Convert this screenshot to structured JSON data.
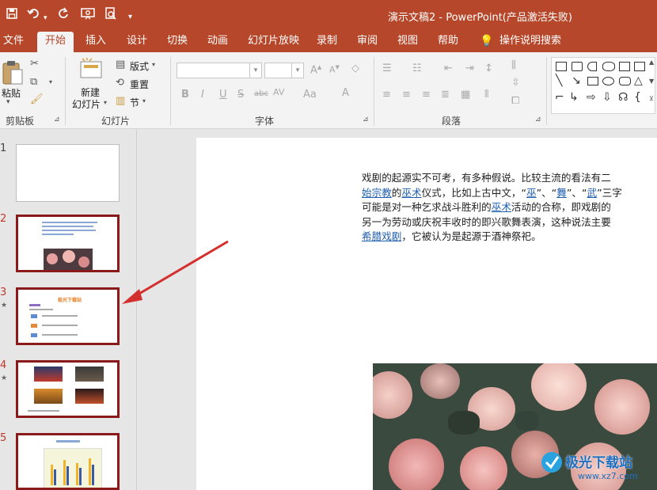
{
  "title_bar": {
    "document_title": "演示文稿2  -  PowerPoint(产品激活失败)",
    "icons": [
      "save-icon",
      "undo-icon",
      "redo-icon",
      "present-icon",
      "preview-icon",
      "customize-icon"
    ]
  },
  "tabs": [
    "文件",
    "开始",
    "插入",
    "设计",
    "切换",
    "动画",
    "幻灯片放映",
    "录制",
    "审阅",
    "视图",
    "帮助",
    "操作说明搜索"
  ],
  "active_tab": "开始",
  "ribbon": {
    "clipboard": {
      "paste": "粘贴",
      "group": "剪贴板"
    },
    "slides": {
      "new_slide_line1": "新建",
      "new_slide_line2": "幻灯片",
      "layout": "版式",
      "reset": "重置",
      "section": "节",
      "group": "幻灯片"
    },
    "font": {
      "group": "字体",
      "font_name": "",
      "font_size": ""
    },
    "paragraph": {
      "group": "段落"
    }
  },
  "thumbnails": [
    {
      "number": "1",
      "selected": false,
      "star": false
    },
    {
      "number": "2",
      "selected": true,
      "star": false
    },
    {
      "number": "3",
      "selected": true,
      "star": true,
      "heading": "极光下载站"
    },
    {
      "number": "4",
      "selected": true,
      "star": true
    },
    {
      "number": "5",
      "selected": true,
      "star": false
    }
  ],
  "slide_text": {
    "line1": "戏剧的起源实不可考，有多种假说。比较主流的看法有二",
    "line2_link1": "始宗教",
    "line2_a": "的",
    "line2_link2": "巫术",
    "line2_b": "仪式，比如上古中文，“",
    "line2_link3": "巫",
    "line2_c": "”、“",
    "line2_link4": "舞",
    "line2_d": "”、“",
    "line2_link5": "武",
    "line2_e": "”三字",
    "line3_a": "可能是对一种乞求战斗胜利的",
    "line3_link": "巫术",
    "line3_b": "活动的合称，即戏剧的",
    "line4": "另一为劳动或庆祝丰收时的即兴歌舞表演，这种说法主要",
    "line5_link": "希腊戏剧",
    "line5_b": "，它被认为是起源于酒神祭祀。"
  },
  "watermark": {
    "text": "极光下载站",
    "url": "www.xz7.com"
  },
  "colors": {
    "accent": "#b7472a",
    "link": "#1f5fb0",
    "selected_border": "#8b1a1a",
    "arrow": "#d32f2f"
  }
}
